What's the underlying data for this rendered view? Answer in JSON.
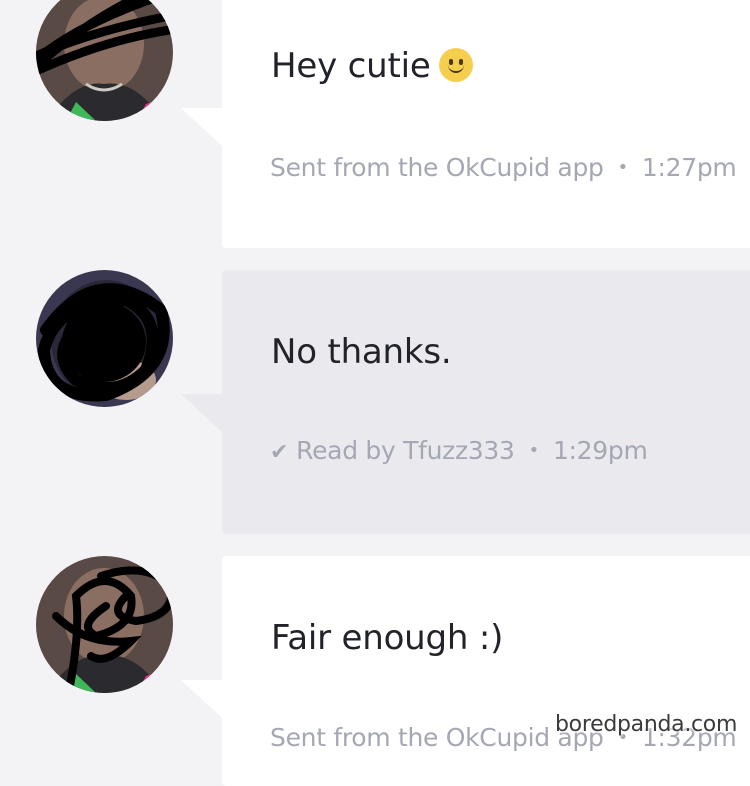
{
  "messages": [
    {
      "text": "Hey cutie",
      "emoji": "slightly-smiling-face",
      "meta_prefix": "Sent from the OkCupid app",
      "time": "1:27pm"
    },
    {
      "text": "No thanks.",
      "meta_prefix": "Read by Tfuzz333",
      "time": "1:29pm",
      "read_icon": "checkmark-icon"
    },
    {
      "text": "Fair enough :)",
      "meta_prefix": "Sent from the OkCupid app",
      "time": "1:32pm"
    }
  ],
  "meta_separator": "•",
  "read_check": "✔",
  "watermark": "boredpanda.com",
  "colors": {
    "background": "#f3f3f6",
    "bubble_sent": "#ffffff",
    "bubble_received": "#e9e9ee",
    "text": "#22232a",
    "meta": "#a5a8b3"
  }
}
